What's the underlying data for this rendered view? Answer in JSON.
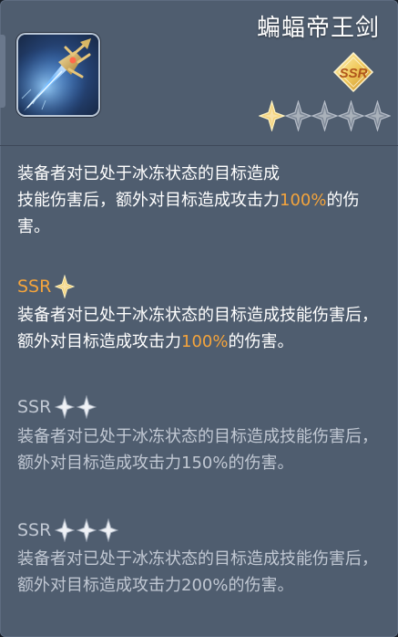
{
  "weapon": {
    "name": "蝙蝠帝王剑",
    "rarity": "SSR",
    "stars_filled": 1,
    "stars_total": 5,
    "icon": "sword-icon"
  },
  "description": {
    "lines": [
      "装备者对已处于冰冻状态的目标造成",
      "技能伤害后，额外对目标造成攻击力"
    ],
    "value": "100%",
    "suffix": "的伤害。"
  },
  "tiers": [
    {
      "label": "SSR",
      "stars": 1,
      "active": true,
      "text": "装备者对已处于冰冻状态的目标造成技能伤害后，额外对目标造成攻击力",
      "value": "100%",
      "suffix": "的伤害。"
    },
    {
      "label": "SSR",
      "stars": 2,
      "active": false,
      "text": "装备者对已处于冰冻状态的目标造成技能伤害后，额外对目标造成攻击力",
      "value": "150%",
      "suffix": "的伤害。"
    },
    {
      "label": "SSR",
      "stars": 3,
      "active": false,
      "text": "装备者对已处于冰冻状态的目标造成技能伤害后，额外对目标造成攻击力",
      "value": "200%",
      "suffix": "的伤害。"
    }
  ],
  "colors": {
    "panel": "#4f5d6f",
    "highlight": "#f4a43c",
    "text": "#ffffff",
    "dim_text": "#c1c8d3",
    "gold_star": "#f3d27a",
    "grey_star": "#b6bdc8"
  }
}
